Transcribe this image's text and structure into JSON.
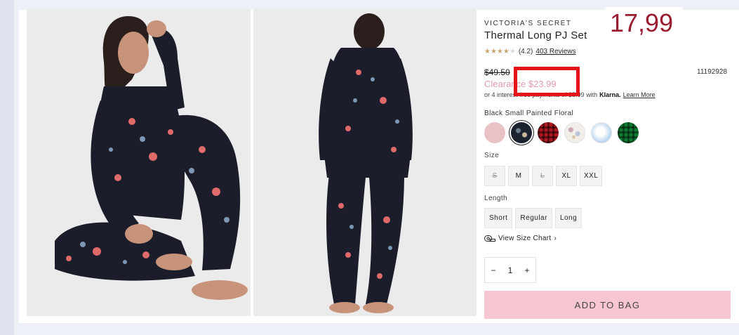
{
  "overlay": {
    "price_note": "17,99"
  },
  "product": {
    "brand": "VICTORIA'S SECRET",
    "title": "Thermal Long PJ Set",
    "rating": "(4.2)",
    "reviews": "403 Reviews",
    "original_price": "$49.50",
    "clearance_price": "Clearance $23.99",
    "sku": "11192928",
    "klarna_prefix": "or 4 interest-free payments of $5.99 with",
    "klarna_brand": "Klarna.",
    "klarna_link": "Learn More",
    "color_name": "Black Small Painted Floral"
  },
  "swatches": [
    "pink",
    "black-small-painted-floral",
    "red-plaid",
    "pastel-floral",
    "light-blue",
    "green-plaid"
  ],
  "size": {
    "label": "Size",
    "options": [
      "S",
      "M",
      "L",
      "XL",
      "XXL"
    ],
    "unavailable": [
      "S",
      "L"
    ]
  },
  "length": {
    "label": "Length",
    "options": [
      "Short",
      "Regular",
      "Long"
    ]
  },
  "size_chart": "View Size Chart",
  "quantity": {
    "minus": "−",
    "value": "1",
    "plus": "+"
  },
  "add_to_bag": "ADD TO BAG",
  "colors": {
    "clearance": "#e59ab3",
    "highlight": "#e6131a",
    "overlay_price": "#9b1b2f",
    "add_to_bag_bg": "#f7c6d0",
    "star": "#c9a46b"
  }
}
